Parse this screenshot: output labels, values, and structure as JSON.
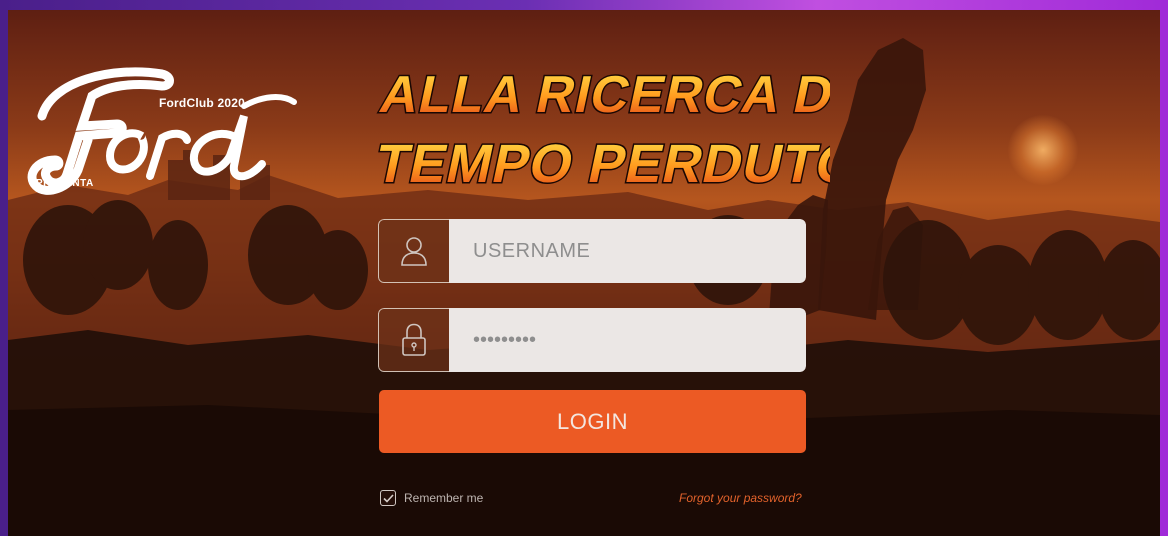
{
  "brand": {
    "logo_text": "Ford",
    "club_label": "FordClub 2020",
    "presenta_label": "PRESENTA"
  },
  "title": {
    "line1": "ALLA RICERCA DEL",
    "line2": "TEMPO PERDUTO"
  },
  "login_form": {
    "username": {
      "placeholder": "USERNAME",
      "value": "",
      "icon": "user-icon"
    },
    "password": {
      "placeholder": "",
      "value": "*********",
      "icon": "lock-icon"
    },
    "login_button_label": "LOGIN",
    "remember_me": {
      "label": "Remember me",
      "checked": true
    },
    "forgot_password_label": "Forgot your password?"
  },
  "colors": {
    "accent": "#ec5a24",
    "input_bg": "#ebe7e5",
    "frame_purple": "#6b2fb3"
  }
}
